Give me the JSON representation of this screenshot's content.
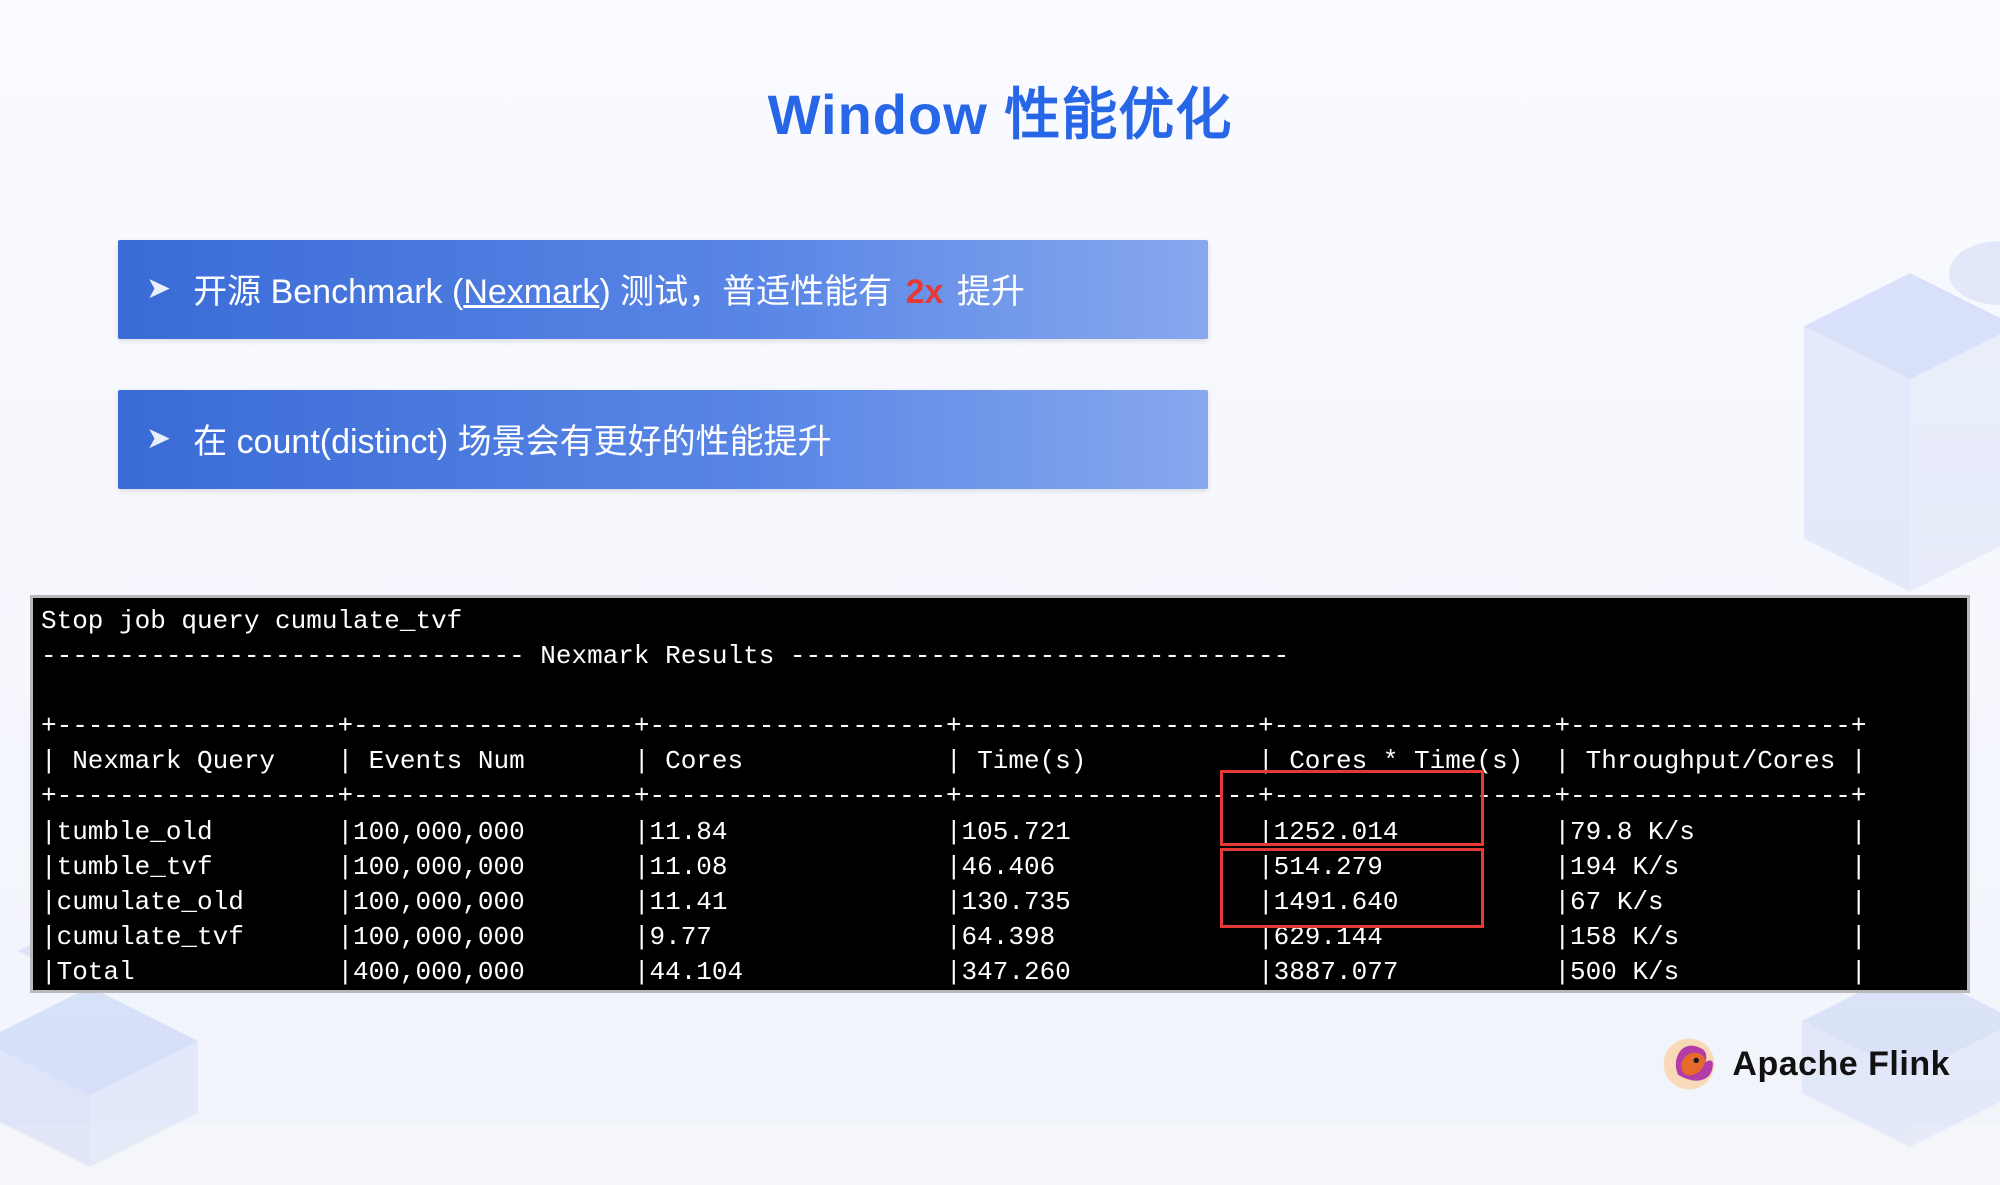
{
  "title": "Window 性能优化",
  "bullets": {
    "b1_pre": "开源 Benchmark (",
    "b1_link": "Nexmark",
    "b1_mid": ") 测试，普适性能有 ",
    "b1_red": "2x",
    "b1_post": " 提升",
    "b2": "在 count(distinct) 场景会有更好的性能提升"
  },
  "terminal": {
    "headerJob": "Stop job query cumulate_tvf",
    "resultsTitle": "------------------------------- Nexmark Results --------------------------------",
    "columns": [
      "Nexmark Query",
      "Events Num",
      "Cores",
      "Time(s)",
      "Cores * Time(s)",
      "Throughput/Cores"
    ],
    "rows": [
      [
        "tumble_old",
        "100,000,000",
        "11.84",
        "105.721",
        "1252.014",
        "79.8 K/s"
      ],
      [
        "tumble_tvf",
        "100,000,000",
        "11.08",
        "46.406",
        "514.279",
        "194 K/s"
      ],
      [
        "cumulate_old",
        "100,000,000",
        "11.41",
        "130.735",
        "1491.640",
        "67 K/s"
      ],
      [
        "cumulate_tvf",
        "100,000,000",
        "9.77",
        "64.398",
        "629.144",
        "158 K/s"
      ],
      [
        "Total",
        "400,000,000",
        "44.104",
        "347.260",
        "3887.077",
        "500 K/s"
      ]
    ]
  },
  "brand": "Apache Flink",
  "chart_data": {
    "type": "table",
    "title": "Nexmark Results",
    "columns": [
      "Nexmark Query",
      "Events Num",
      "Cores",
      "Time(s)",
      "Cores * Time(s)",
      "Throughput/Cores"
    ],
    "rows": [
      {
        "query": "tumble_old",
        "events": 100000000,
        "cores": 11.84,
        "time_s": 105.721,
        "cores_times_time": 1252.014,
        "throughput_per_core": "79.8 K/s"
      },
      {
        "query": "tumble_tvf",
        "events": 100000000,
        "cores": 11.08,
        "time_s": 46.406,
        "cores_times_time": 514.279,
        "throughput_per_core": "194 K/s"
      },
      {
        "query": "cumulate_old",
        "events": 100000000,
        "cores": 11.41,
        "time_s": 130.735,
        "cores_times_time": 1491.64,
        "throughput_per_core": "67 K/s"
      },
      {
        "query": "cumulate_tvf",
        "events": 100000000,
        "cores": 9.77,
        "time_s": 64.398,
        "cores_times_time": 629.144,
        "throughput_per_core": "158 K/s"
      },
      {
        "query": "Total",
        "events": 400000000,
        "cores": 44.104,
        "time_s": 347.26,
        "cores_times_time": 3887.077,
        "throughput_per_core": "500 K/s"
      }
    ],
    "highlighted_column": "Cores * Time(s)",
    "highlighted_rows": [
      "tumble_old",
      "tumble_tvf",
      "cumulate_old",
      "cumulate_tvf"
    ]
  }
}
